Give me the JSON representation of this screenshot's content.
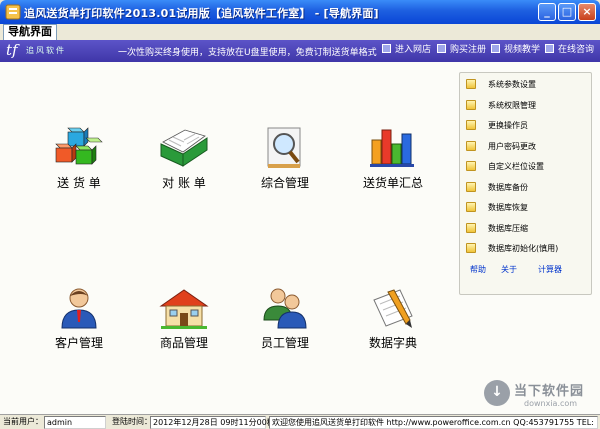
{
  "window": {
    "title": "追风送货单打印软件2013.01试用版【追风软件工作室】 - [导航界面]",
    "minimize": "_",
    "maximize": "□",
    "close": "×"
  },
  "tab": {
    "label": "导航界面"
  },
  "banner": {
    "logo": "tf",
    "logo_text": "追风软件",
    "slogan": "一次性购买终身使用，支持放在U盘里使用，免费订制送货单格式",
    "links": [
      "进入网店",
      "购买注册",
      "视频教学",
      "在线咨询"
    ]
  },
  "modules": {
    "delivery": {
      "label": "送 货 单",
      "icon": "cubes-icon"
    },
    "reconcile": {
      "label": "对 账 单",
      "icon": "open-book-icon"
    },
    "overview": {
      "label": "综合管理",
      "icon": "magnifier-icon"
    },
    "summary": {
      "label": "送货单汇总",
      "icon": "bar-chart-icon"
    },
    "customer": {
      "label": "客户管理",
      "icon": "user-icon"
    },
    "product": {
      "label": "商品管理",
      "icon": "house-icon"
    },
    "staff": {
      "label": "员工管理",
      "icon": "users-icon"
    },
    "dictionary": {
      "label": "数据字典",
      "icon": "notepad-pencil-icon"
    }
  },
  "panel": {
    "items": [
      "系统参数设置",
      "系统权限管理",
      "更换操作员",
      "用户密码更改",
      "自定义栏位设置",
      "数据库备份",
      "数据库恢复",
      "数据库压缩",
      "数据库初始化(慎用)"
    ],
    "links": {
      "help": "帮助",
      "about": "关于",
      "calculator": "计算器"
    }
  },
  "status": {
    "user_label": "当前用户：",
    "user": "admin",
    "login_label": "登陆时间：",
    "login_time": "2012年12月28日 09时11分00秒",
    "message": "欢迎您使用追风送货单打印软件 http://www.poweroffice.com.cn QQ:453791755 TEL:"
  },
  "watermark": {
    "text": "当下软件园",
    "url": "downxia.com"
  }
}
